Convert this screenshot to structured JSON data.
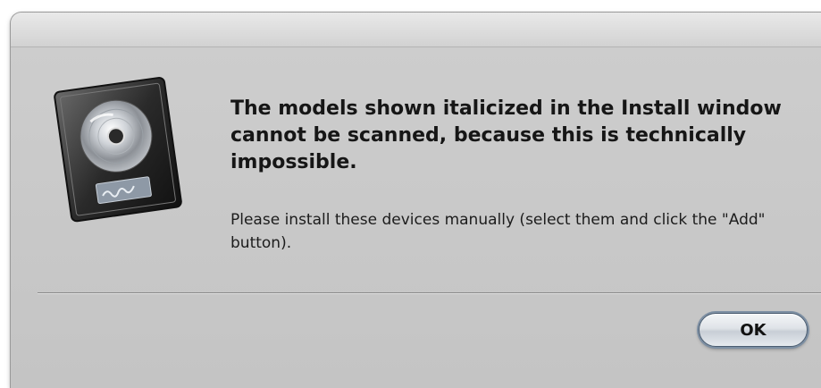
{
  "dialog": {
    "icon": "logic-app-icon",
    "heading": "The models shown italicized in the Install window cannot be scanned, because this is technically impossible.",
    "message": "Please install these devices manually (select them and click the \"Add\" button).",
    "ok_label": "OK"
  }
}
